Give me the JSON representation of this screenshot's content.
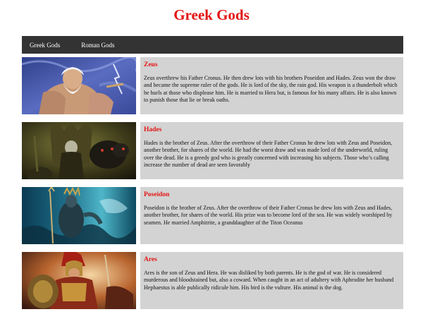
{
  "page": {
    "title": "Greek Gods"
  },
  "nav": {
    "items": [
      "Greek Gods",
      "Roman Gods"
    ]
  },
  "gods": [
    {
      "name": "Zeus",
      "description": "Zeus overthrew his Father Cronus. He then drew lots with his brothers Poseidon and Hades. Zeus won the draw and became the supreme ruler of the gods. He is lord of the sky, the rain god. His weapon is a thunderbolt which he hurls at those who displease him. He is married to Hera but, is famous for his many affairs. He is also known to punish those that lie or break oaths.",
      "image_icon": "zeus-portrait"
    },
    {
      "name": "Hades",
      "description": "Hades is the brother of Zeus. After the overthrow of their Father Cronus he drew lots with Zeus and Poseidon, another brother, for shares of the world. He had the worst draw and was made lord of the underworld, ruling over the dead. He is a greedy god who is greatly concerned with increasing his subjects. Those who’s calling increase the number of dead are seen favorably",
      "image_icon": "hades-portrait"
    },
    {
      "name": "Poseidon",
      "description": "Poseidon is the brother of Zeus. After the overthrow of their Father Cronus he drew lots with Zeus and Hades, another brother, for shares of the world. His prize was to become lord of the sea. He was widely worshiped by seamen. He married Amphitrite, a granddaughter of the Titon Oceanus",
      "image_icon": "poseidon-portrait"
    },
    {
      "name": "Ares",
      "description": "Ares is the son of Zeus and Hera. He was disliked by both parents. He is the god of war. He is considered murderous and bloodstained but, also a coward. When caught in an act of adultery with Aphrodite her husband Hephaestus is able publically ridicule him. His bird is the vulture. His animal is the dog.",
      "image_icon": "ares-portrait"
    }
  ],
  "colors": {
    "title": "#e31414",
    "navbar": "#333333",
    "card_bg": "#d3d3d3"
  }
}
